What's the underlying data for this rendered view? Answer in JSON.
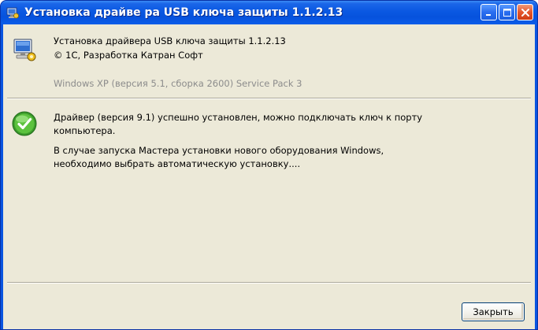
{
  "window": {
    "title": "Установка драйве ра USB ключа защиты 1.1.2.13",
    "icon": "setup-icon"
  },
  "header": {
    "product_line": "Установка драйвера USB ключа защиты 1.1.2.13",
    "copyright_line": "© 1С, Разработка Катран Софт",
    "os_line": "Windows XP (версия 5.1, сборка 2600) Service Pack 3",
    "icon": "computer-icon"
  },
  "message": {
    "icon": "success-check-icon",
    "line1": "Драйвер (версия 9.1) успешно установлен, можно подключать ключ к порту",
    "line2": "компьютера.",
    "line3": "В случае запуска Мастера установки нового оборудования Windows,",
    "line4": "необходимо выбрать автоматическую установку...."
  },
  "buttons": {
    "close_label": "Закрыть"
  },
  "colors": {
    "titlebar": "#0a58e2",
    "client_bg": "#ece9d8",
    "os_text": "#8c8c8c",
    "close_btn": "#e4562c"
  }
}
